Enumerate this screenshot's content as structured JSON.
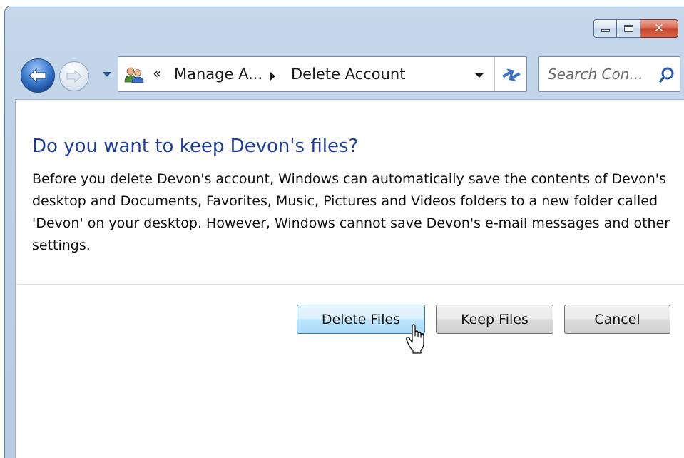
{
  "titlebar": {
    "minimize": "minimize-icon",
    "maximize": "maximize-icon",
    "close": "close-icon"
  },
  "nav": {
    "back_icon": "back-arrow-icon",
    "forward_icon": "forward-arrow-icon"
  },
  "address": {
    "overflow": "«",
    "crumbs": [
      "Manage A...",
      "Delete Account"
    ]
  },
  "search": {
    "placeholder": "Search Con..."
  },
  "dialog": {
    "heading": "Do you want to keep Devon's files?",
    "body": "Before you delete Devon's account, Windows can automatically save the contents of Devon's desktop and Documents, Favorites, Music, Pictures and Videos folders to a new folder called 'Devon' on your desktop. However, Windows cannot save Devon's e-mail messages and other settings."
  },
  "buttons": {
    "delete": "Delete Files",
    "keep": "Keep Files",
    "cancel": "Cancel"
  },
  "colors": {
    "heading": "#1f3f9a",
    "close_button": "#c5432a",
    "default_button_border": "#3c7fb1"
  }
}
